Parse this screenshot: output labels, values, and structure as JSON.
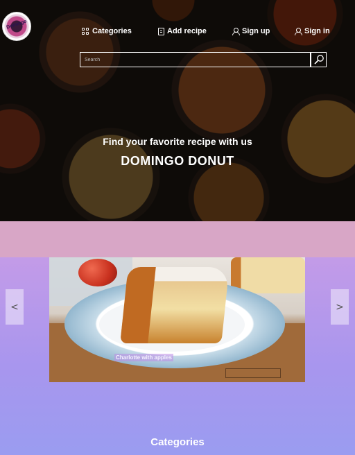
{
  "header": {
    "logo_text": "Domingo",
    "nav": [
      {
        "label": "Categories",
        "icon": "grid-icon"
      },
      {
        "label": "Add recipe",
        "icon": "document-icon"
      },
      {
        "label": "Sign up",
        "icon": "user-icon"
      },
      {
        "label": "Sign in",
        "icon": "user-icon"
      }
    ],
    "search": {
      "placeholder": "Search",
      "value": ""
    }
  },
  "hero": {
    "tagline": "Find your favorite recipe with us",
    "brand": "DOMINGO DONUT"
  },
  "carousel": {
    "caption": "Charlotte with apples",
    "prev_label": "<",
    "next_label": ">"
  },
  "sections": {
    "categories_title": "Categories"
  },
  "colors": {
    "band": "#d8a6c6",
    "gradient_top": "#c39be8",
    "gradient_bottom": "#9a9cf0"
  }
}
